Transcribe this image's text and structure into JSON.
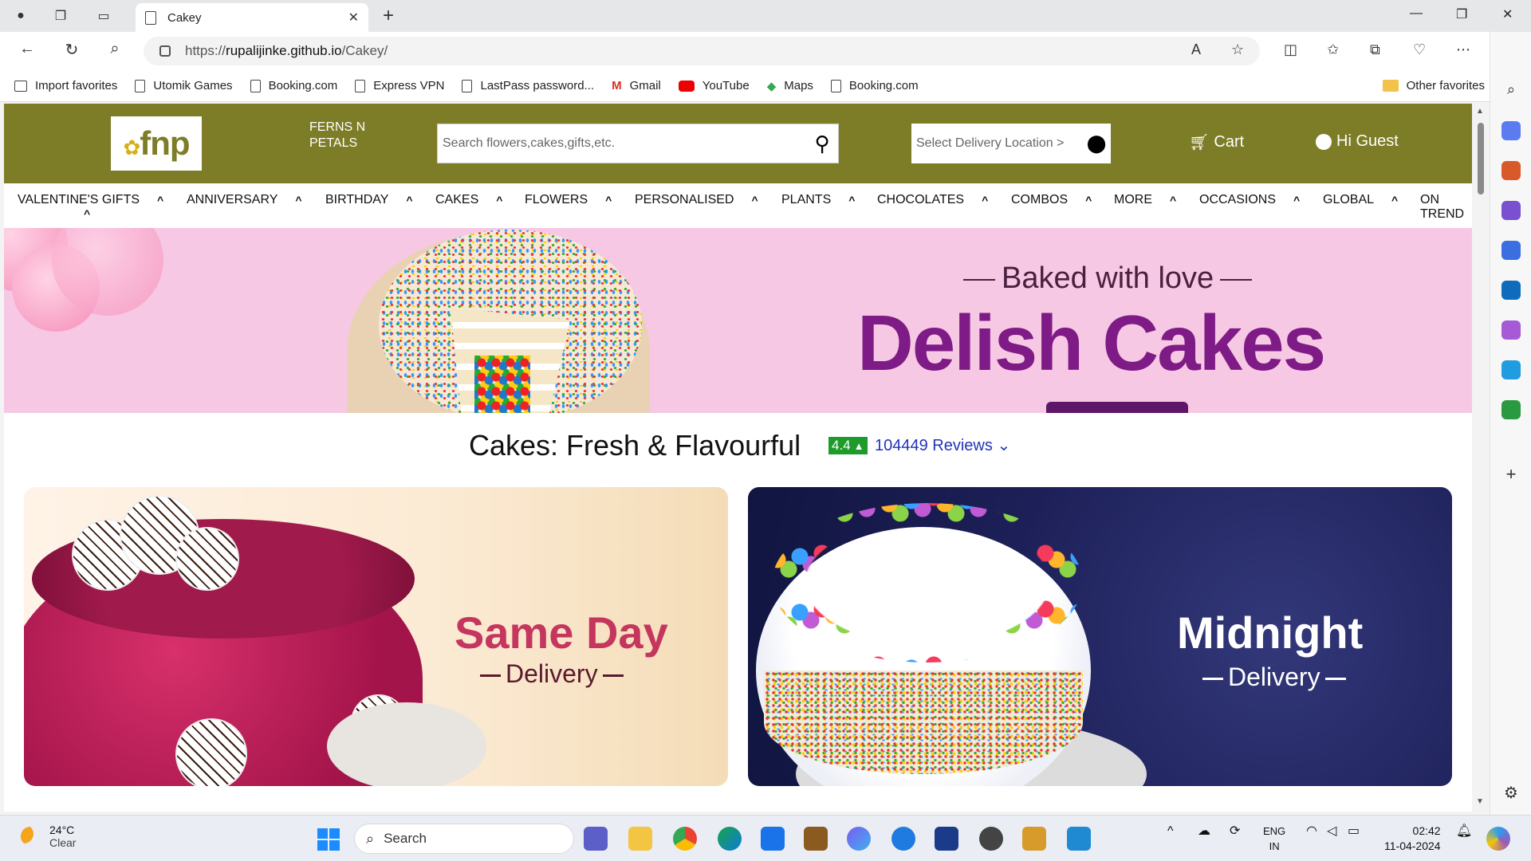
{
  "browser": {
    "tab_title": "Cakey",
    "url_prefix": "https://",
    "url_host": "rupalijinke.github.io",
    "url_path": "/Cakey/",
    "favorites": [
      {
        "label": "Import favorites",
        "icon": "import-icon"
      },
      {
        "label": "Utomik Games",
        "icon": "page-icon"
      },
      {
        "label": "Booking.com",
        "icon": "page-icon"
      },
      {
        "label": "Express VPN",
        "icon": "page-icon"
      },
      {
        "label": "LastPass password...",
        "icon": "page-icon"
      },
      {
        "label": "Gmail",
        "icon": "gmail-icon"
      },
      {
        "label": "YouTube",
        "icon": "youtube-icon"
      },
      {
        "label": "Maps",
        "icon": "maps-icon"
      },
      {
        "label": "Booking.com",
        "icon": "page-icon"
      }
    ],
    "other_favorites": "Other favorites"
  },
  "site": {
    "logo_text": "fnp",
    "brand_name": "FERNS N PETALS",
    "search_placeholder": "Search flowers,cakes,gifts,etc.",
    "location_text": "Select Delivery Location >",
    "cart_label": "Cart",
    "guest_label": "Hi Guest",
    "menu": [
      "VALENTINE'S GIFTS",
      "ANNIVERSARY",
      "BIRTHDAY",
      "CAKES",
      "FLOWERS",
      "PERSONALISED",
      "PLANTS",
      "CHOCOLATES",
      "COMBOS",
      "MORE",
      "OCCASIONS",
      "GLOBAL",
      "ON TREND"
    ],
    "banner": {
      "tagline": "Baked with love",
      "headline": "Delish Cakes"
    },
    "section_title": "Cakes: Fresh & Flavourful",
    "rating": "4.4",
    "reviews": "104449 Reviews",
    "cards": [
      {
        "title": "Same Day",
        "subtitle": "Delivery"
      },
      {
        "title": "Midnight",
        "subtitle": "Delivery"
      }
    ],
    "accent_color": "#7d7d27",
    "rating_color": "#1e9b2a"
  },
  "taskbar": {
    "temperature": "24°C",
    "weather": "Clear",
    "search_label": "Search",
    "lang": "ENG",
    "region": "IN",
    "time": "02:42",
    "date": "11-04-2024"
  }
}
